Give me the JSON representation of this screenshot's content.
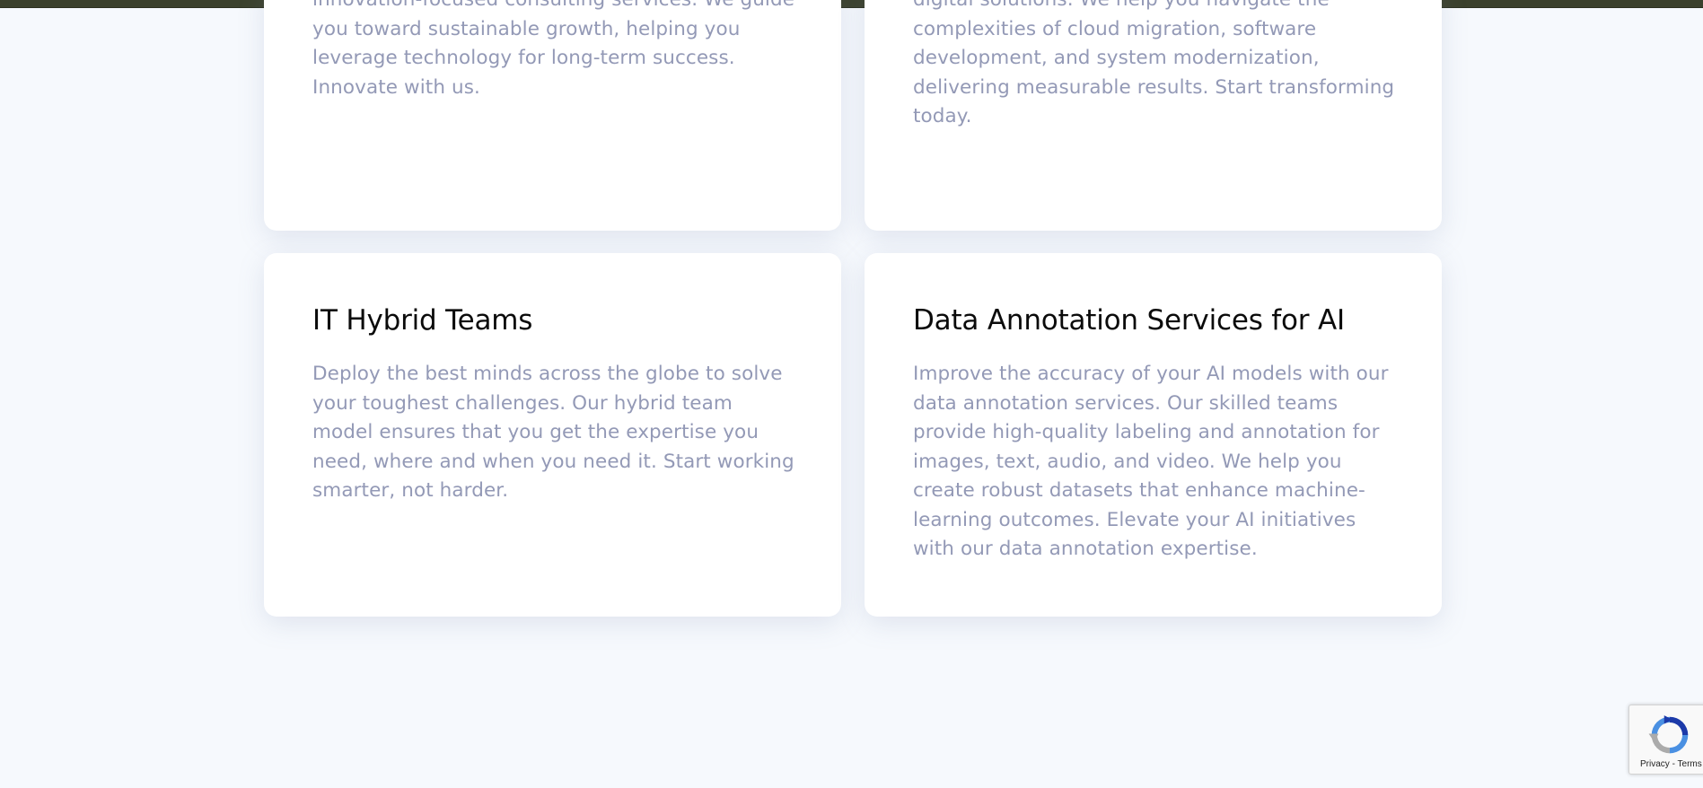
{
  "cards": [
    {
      "title": "",
      "description": "innovation-focused consulting services. We guide you toward sustainable growth, helping you leverage technology for long-term success. Innovate with us."
    },
    {
      "title": "",
      "description": "digital solutions. We help you navigate the complexities of cloud migration, software development, and system modernization, delivering measurable results. Start transforming today."
    },
    {
      "title": "IT Hybrid Teams",
      "description": "Deploy the best minds across the globe to solve your toughest challenges. Our hybrid team model ensures that you get the expertise you need, where and when you need it. Start working smarter, not harder."
    },
    {
      "title": "Data Annotation Services for AI",
      "description": "Improve the accuracy of your AI models with our data annotation services. Our skilled teams provide high-quality labeling and annotation for images, text, audio, and video. We help you create robust datasets that enhance machine-learning outcomes. Elevate your AI initiatives with our data annotation expertise."
    }
  ],
  "recaptcha": {
    "privacy_label": "Privacy",
    "separator": " - ",
    "terms_label": "Terms",
    "icon": "recaptcha-icon"
  },
  "colors": {
    "page_background": "#f6f9fd",
    "top_bar": "#3b412d",
    "card_background": "#ffffff",
    "title_text": "#0b0b0b",
    "body_text": "#9399b6"
  }
}
